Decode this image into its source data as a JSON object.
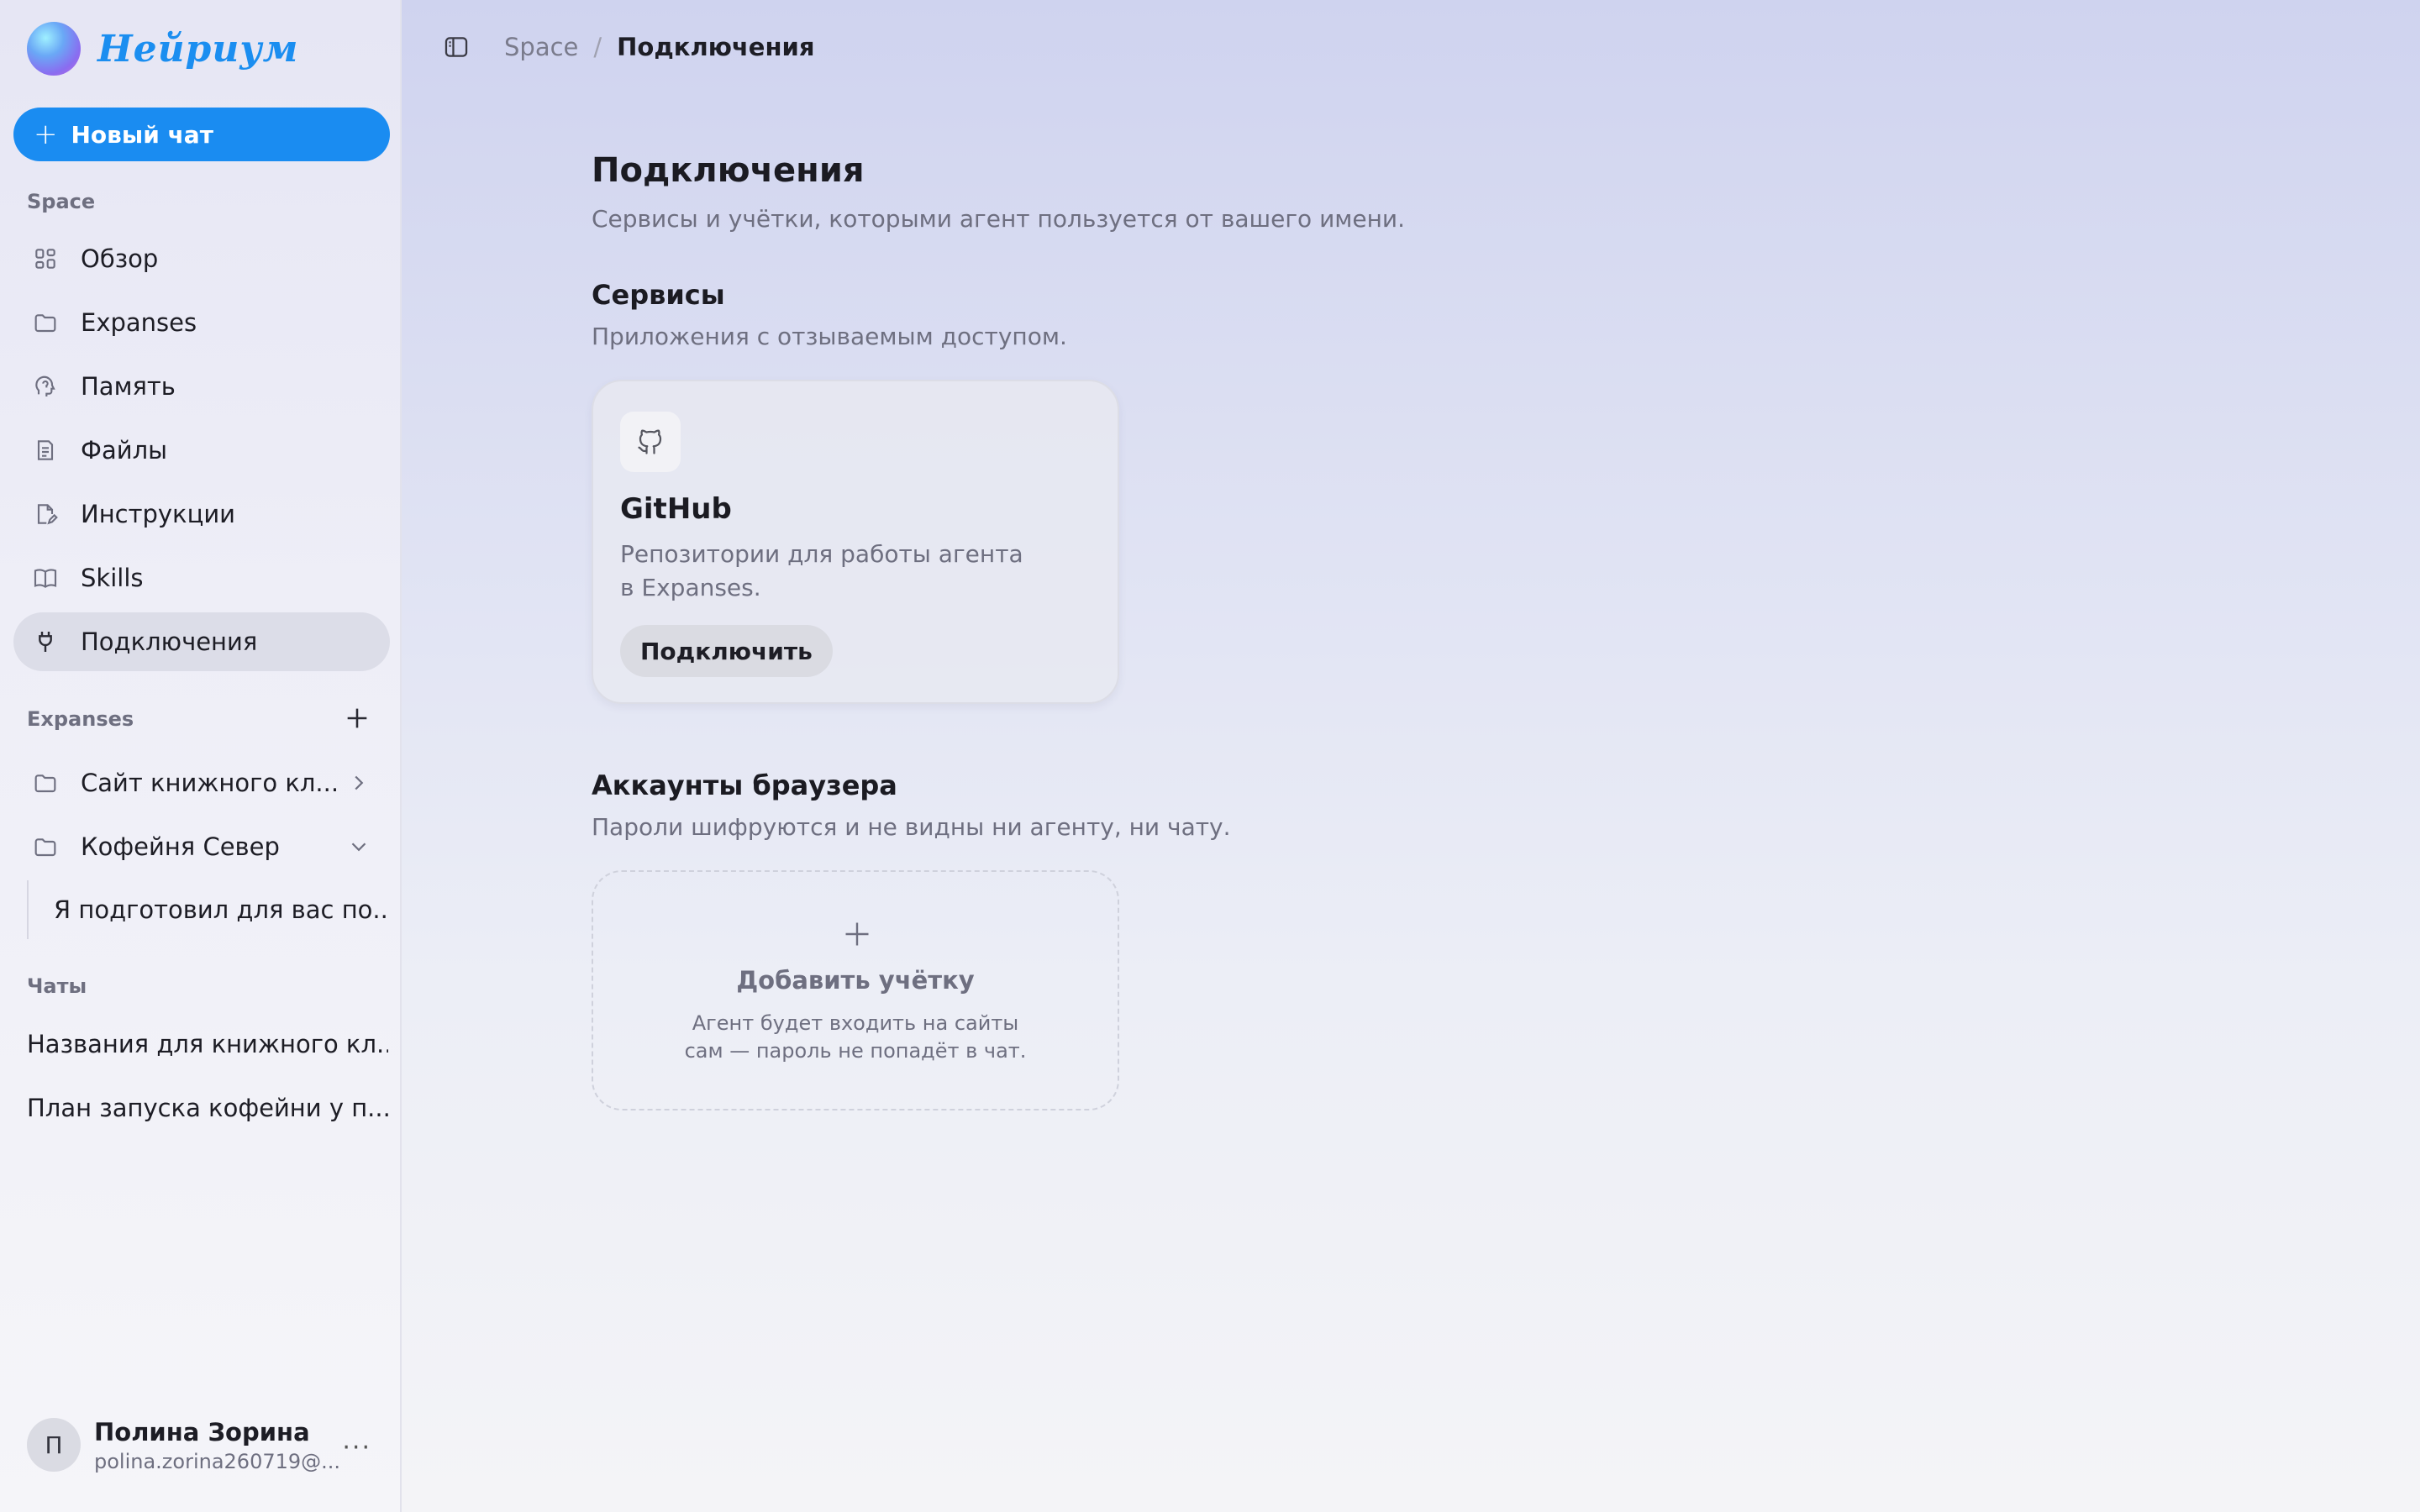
{
  "brand": {
    "name": "Нейриум"
  },
  "sidebar": {
    "new_chat_label": "Новый чат",
    "space_label": "Space",
    "space_items": [
      {
        "label": "Обзор",
        "icon": "grid-icon"
      },
      {
        "label": "Expanses",
        "icon": "folder-icon"
      },
      {
        "label": "Память",
        "icon": "brain-head-icon"
      },
      {
        "label": "Файлы",
        "icon": "file-icon"
      },
      {
        "label": "Инструкции",
        "icon": "file-pen-icon"
      },
      {
        "label": "Skills",
        "icon": "book-icon"
      },
      {
        "label": "Подключения",
        "icon": "plug-icon",
        "active": true
      }
    ],
    "expanses_label": "Expanses",
    "expanses": [
      {
        "label": "Сайт книжного кл...",
        "icon": "folder-icon",
        "state": "collapsed"
      },
      {
        "label": "Кофейня Север",
        "icon": "folder-icon",
        "state": "expanded"
      }
    ],
    "expanse_sub_item": "Я подготовил для вас по...",
    "chats_label": "Чаты",
    "chats": [
      {
        "label": "Названия для книжного кл..."
      },
      {
        "label": "План запуска кофейни у п..."
      }
    ],
    "user": {
      "initial": "П",
      "name": "Полина Зорина",
      "email": "polina.zorina260719@..."
    }
  },
  "breadcrumb": {
    "root": "Space",
    "separator": "/",
    "current": "Подключения"
  },
  "page": {
    "title": "Подключения",
    "subtitle": "Сервисы и учётки, которыми агент пользуется от вашего имени."
  },
  "services": {
    "title": "Сервисы",
    "subtitle": "Приложения с отзываемым доступом.",
    "card": {
      "icon": "github-icon",
      "title": "GitHub",
      "description_line1": "Репозитории для работы агента",
      "description_line2": "в Expanses.",
      "button": "Подключить"
    }
  },
  "browser_accounts": {
    "title": "Аккаунты браузера",
    "subtitle": "Пароли шифруются и не видны ни агенту, ни чату.",
    "add_card": {
      "title": "Добавить учётку",
      "description_line1": "Агент будет входить на сайты",
      "description_line2": "сам — пароль не попадёт в чат."
    }
  },
  "colors": {
    "accent": "#1a8cf1",
    "active_nav": "#dcdde8"
  }
}
